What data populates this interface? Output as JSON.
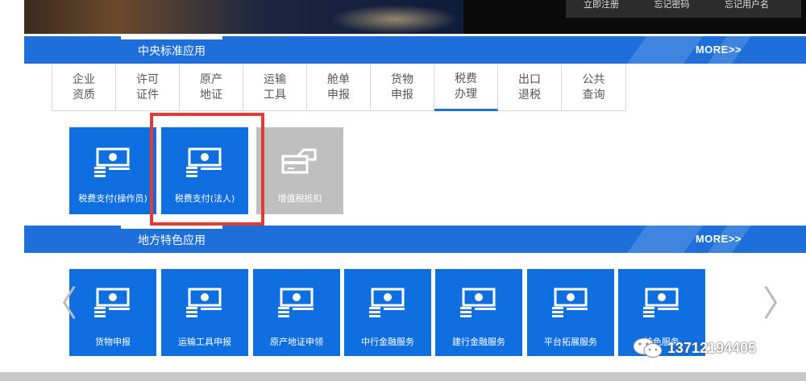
{
  "banner": {
    "links": [
      "立即注册",
      "忘记密码",
      "忘记用户名"
    ]
  },
  "central": {
    "title": "中央标准应用",
    "more": "MORE>>",
    "tabs": [
      {
        "l1": "企业",
        "l2": "资质"
      },
      {
        "l1": "许可",
        "l2": "证件"
      },
      {
        "l1": "原产",
        "l2": "地证"
      },
      {
        "l1": "运输",
        "l2": "工具"
      },
      {
        "l1": "舱单",
        "l2": "申报"
      },
      {
        "l1": "货物",
        "l2": "申报"
      },
      {
        "l1": "税费",
        "l2": "办理"
      },
      {
        "l1": "出口",
        "l2": "退税"
      },
      {
        "l1": "公共",
        "l2": "查询"
      }
    ],
    "active_tab": "税费办理",
    "tiles": [
      "税费支付(操作员)",
      "税费支付(法人)",
      "增值税抵扣"
    ]
  },
  "local": {
    "title": "地方特色应用",
    "more": "MORE>>",
    "tiles": [
      "货物申报",
      "运输工具申报",
      "原产地证申领",
      "中行金融服务",
      "建行金融服务",
      "平台拓展服务",
      "特色服务"
    ]
  },
  "nav": {
    "prev": "〈",
    "next": "〉"
  },
  "watermark": {
    "text": "13712194405"
  },
  "colors": {
    "brand_blue": "#1e6fd9",
    "tile_blue": "#0f6ee0",
    "disabled": "#bfbfbf",
    "highlight": "#e53935"
  }
}
